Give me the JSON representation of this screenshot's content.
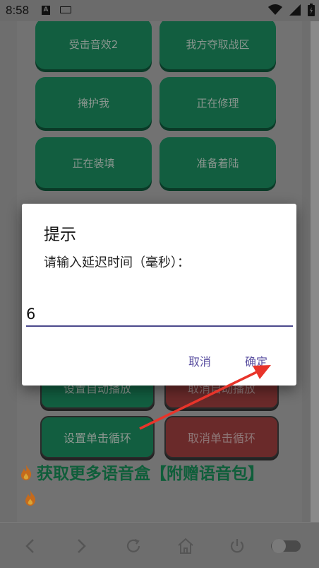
{
  "status_bar": {
    "time": "8:58",
    "icons": [
      "a-icon",
      "keyboard-icon",
      "wifi-icon",
      "signal-icon",
      "battery-icon"
    ]
  },
  "sound_buttons": [
    {
      "label": "受击音效2"
    },
    {
      "label": "我方夺取战区"
    },
    {
      "label": "掩护我"
    },
    {
      "label": "正在修理"
    },
    {
      "label": "正在装填"
    },
    {
      "label": "准备着陆"
    }
  ],
  "controls": {
    "autoplay_label": "设置自动播放",
    "cancel_autoplay_label": "取消自动播放",
    "single_loop_label": "设置单击循环",
    "cancel_single_loop_label": "取消单击循环"
  },
  "promo": {
    "text": "获取更多语音盒【附赠语音包】"
  },
  "dialog": {
    "title": "提示",
    "message": "请输入延迟时间（毫秒）：",
    "input_value": "6",
    "cancel_label": "取消",
    "confirm_label": "确定"
  },
  "colors": {
    "green_button": "#125e40",
    "red_button": "#6a2a2a",
    "dialog_accent": "#5a4fa0",
    "annotation_arrow": "#e8342a"
  },
  "navbar": {
    "icons": [
      "back-icon",
      "forward-icon",
      "refresh-icon",
      "home-icon",
      "power-icon",
      "toggle-icon"
    ]
  }
}
